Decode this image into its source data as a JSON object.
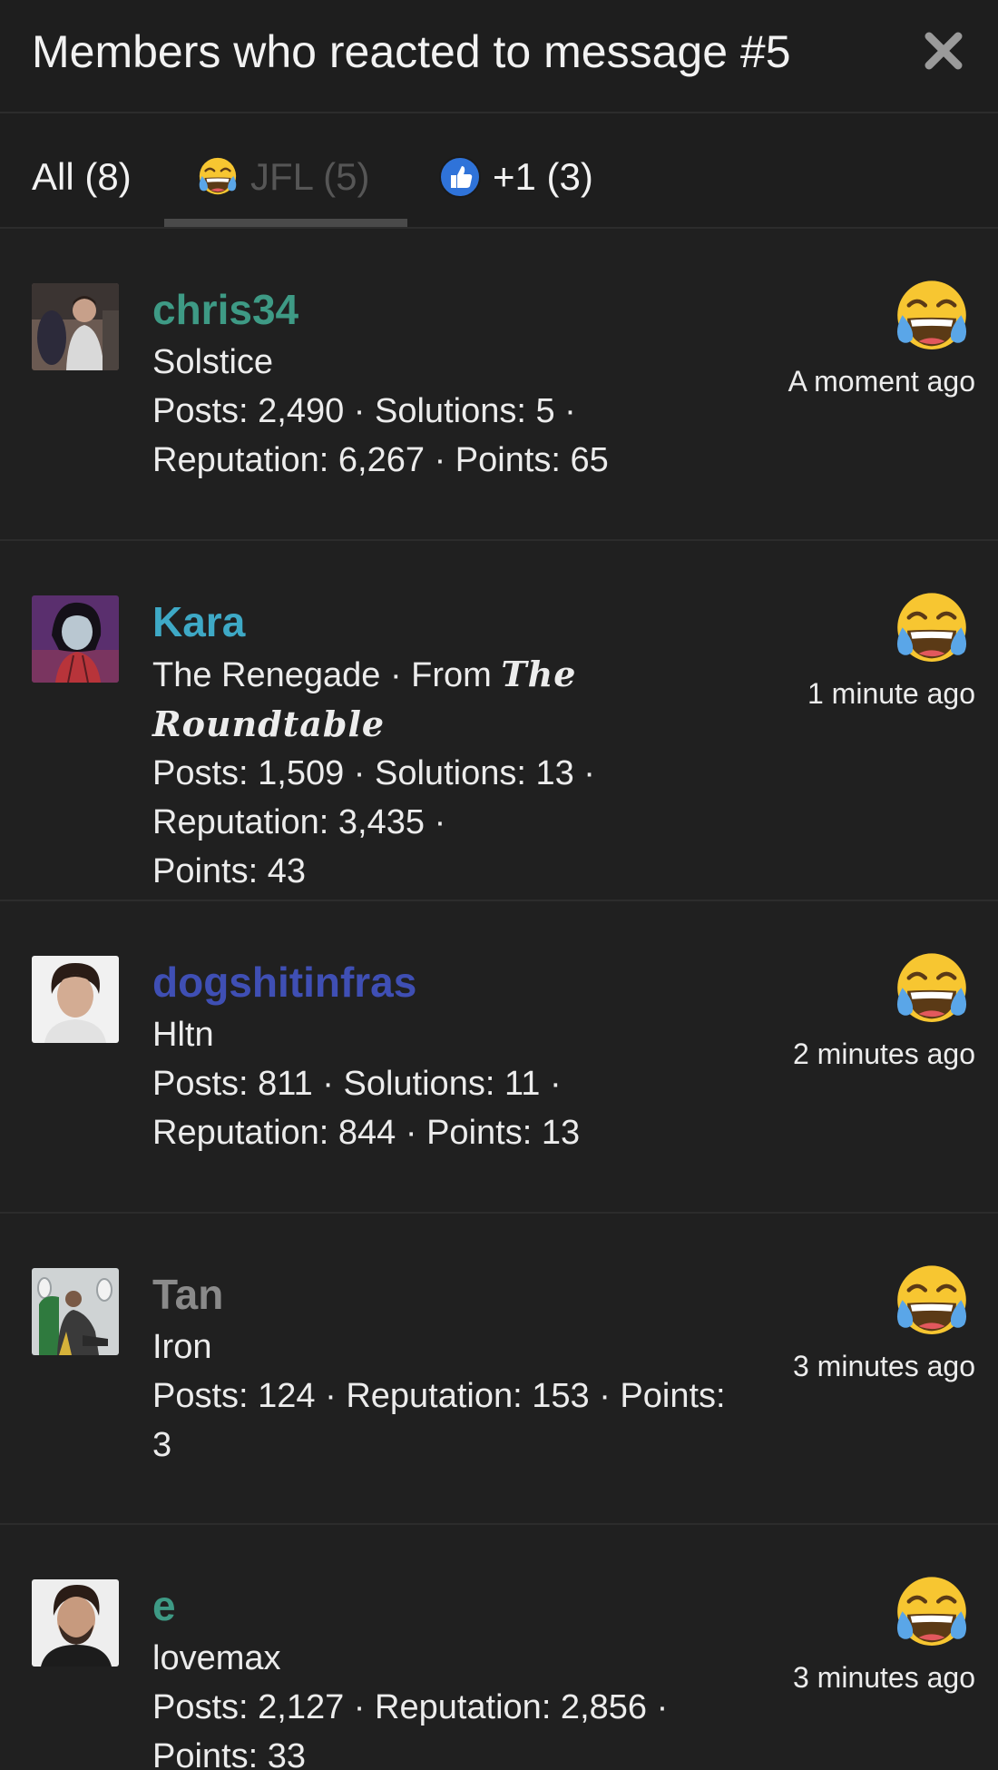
{
  "header": {
    "title": "Members who reacted to message #5"
  },
  "tabs": [
    {
      "label": "All (8)",
      "active": false
    },
    {
      "label": "JFL (5)",
      "active": true,
      "icon": "laughing-crying-emoji-icon"
    },
    {
      "label": "+1 (3)",
      "active": false,
      "icon": "thumbs-up-icon"
    }
  ],
  "colors": {
    "background": "#202020",
    "chris34": "#3e9a85",
    "Kara": "#3ea9c6",
    "dogshitinfras": "#3f4fb4",
    "Tan": "#8a8a8a",
    "e": "#3e9a85"
  },
  "members": [
    {
      "username": "chris34",
      "title": "Solstice",
      "stats": [
        "Posts: 2,490 · Solutions: 5 ·",
        "Reputation: 6,267 · Points: 65"
      ],
      "time": "A moment ago",
      "reaction_icon": "laughing-crying-emoji-icon"
    },
    {
      "username": "Kara",
      "title": "The Renegade · From ",
      "title_styled_1": "The",
      "title_styled_2": "Roundtable",
      "stats": [
        "Posts: 1,509 · Solutions: 13 · Reputation: 3,435 ·",
        "Points: 43"
      ],
      "time": "1 minute ago",
      "reaction_icon": "laughing-crying-emoji-icon"
    },
    {
      "username": "dogshitinfras",
      "title": "Hltn",
      "stats": [
        "Posts: 811 · Solutions: 11 ·",
        "Reputation: 844 · Points: 13"
      ],
      "time": "2 minutes ago",
      "reaction_icon": "laughing-crying-emoji-icon"
    },
    {
      "username": "Tan",
      "title": "Iron",
      "stats": [
        "Posts: 124 · Reputation: 153 · Points:",
        "3"
      ],
      "time": "3 minutes ago",
      "reaction_icon": "laughing-crying-emoji-icon"
    },
    {
      "username": "e",
      "title": "lovemax",
      "stats": [
        "Posts: 2,127 · Reputation: 2,856 ·",
        "Points: 33"
      ],
      "time": "3 minutes ago",
      "reaction_icon": "laughing-crying-emoji-icon"
    }
  ]
}
